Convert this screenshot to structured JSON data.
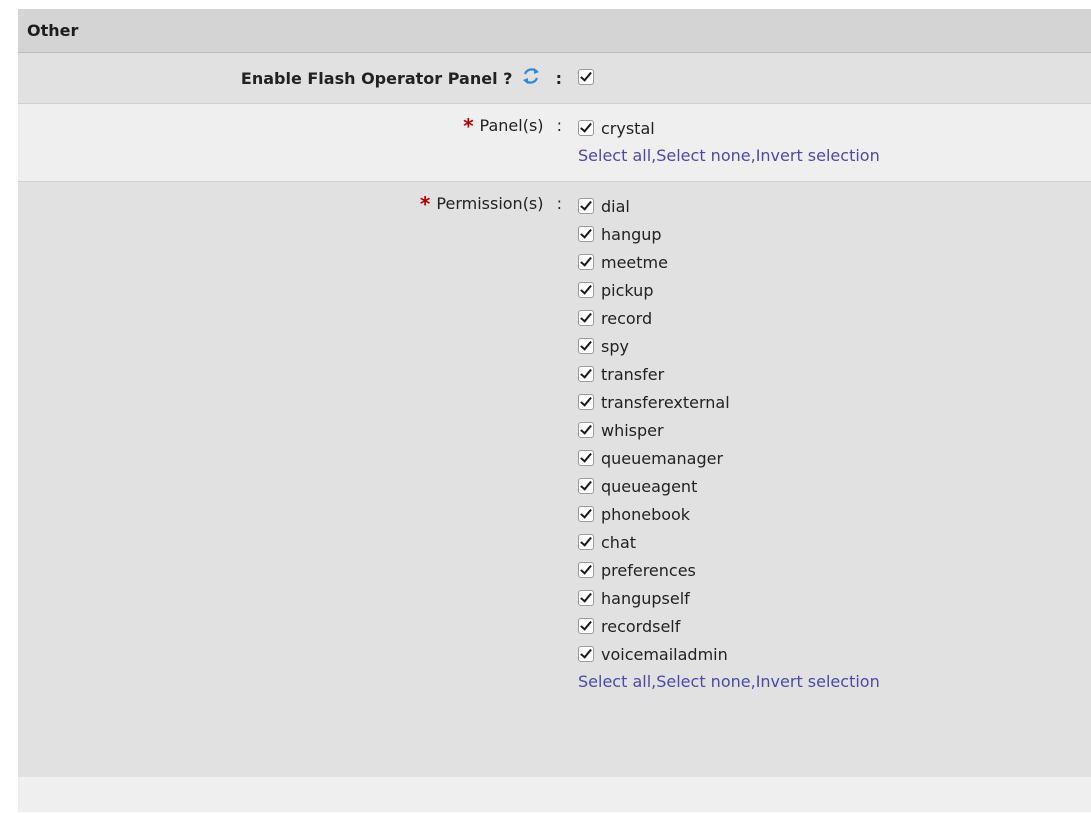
{
  "section": {
    "title": "Other"
  },
  "enable_fop": {
    "label": "Enable Flash Operator Panel ?",
    "colon": ":",
    "checked": true
  },
  "panels": {
    "required_mark": "*",
    "label": "Panel(s)",
    "colon": ":",
    "options": [
      {
        "label": "crystal",
        "checked": true
      }
    ],
    "links": {
      "select_all": "Select all",
      "select_none": "Select none",
      "invert": "Invert selection",
      "sep": ", "
    }
  },
  "permissions": {
    "required_mark": "*",
    "label": "Permission(s)",
    "colon": ":",
    "options": [
      {
        "label": "dial",
        "checked": true
      },
      {
        "label": "hangup",
        "checked": true
      },
      {
        "label": "meetme",
        "checked": true
      },
      {
        "label": "pickup",
        "checked": true
      },
      {
        "label": "record",
        "checked": true
      },
      {
        "label": "spy",
        "checked": true
      },
      {
        "label": "transfer",
        "checked": true
      },
      {
        "label": "transferexternal",
        "checked": true
      },
      {
        "label": "whisper",
        "checked": true
      },
      {
        "label": "queuemanager",
        "checked": true
      },
      {
        "label": "queueagent",
        "checked": true
      },
      {
        "label": "phonebook",
        "checked": true
      },
      {
        "label": "chat",
        "checked": true
      },
      {
        "label": "preferences",
        "checked": true
      },
      {
        "label": "hangupself",
        "checked": true
      },
      {
        "label": "recordself",
        "checked": true
      },
      {
        "label": "voicemailadmin",
        "checked": true
      }
    ],
    "links": {
      "select_all": "Select all",
      "select_none": "Select none",
      "invert": "Invert selection",
      "sep": ", "
    }
  },
  "colors": {
    "header_bg": "#d4d4d4",
    "row_dark": "#e1e1e1",
    "row_light": "#efefef",
    "link": "#4a4aa6",
    "required": "#b00000",
    "refresh_icon": "#2b8ad9"
  },
  "icons": {
    "refresh": "refresh-icon"
  }
}
